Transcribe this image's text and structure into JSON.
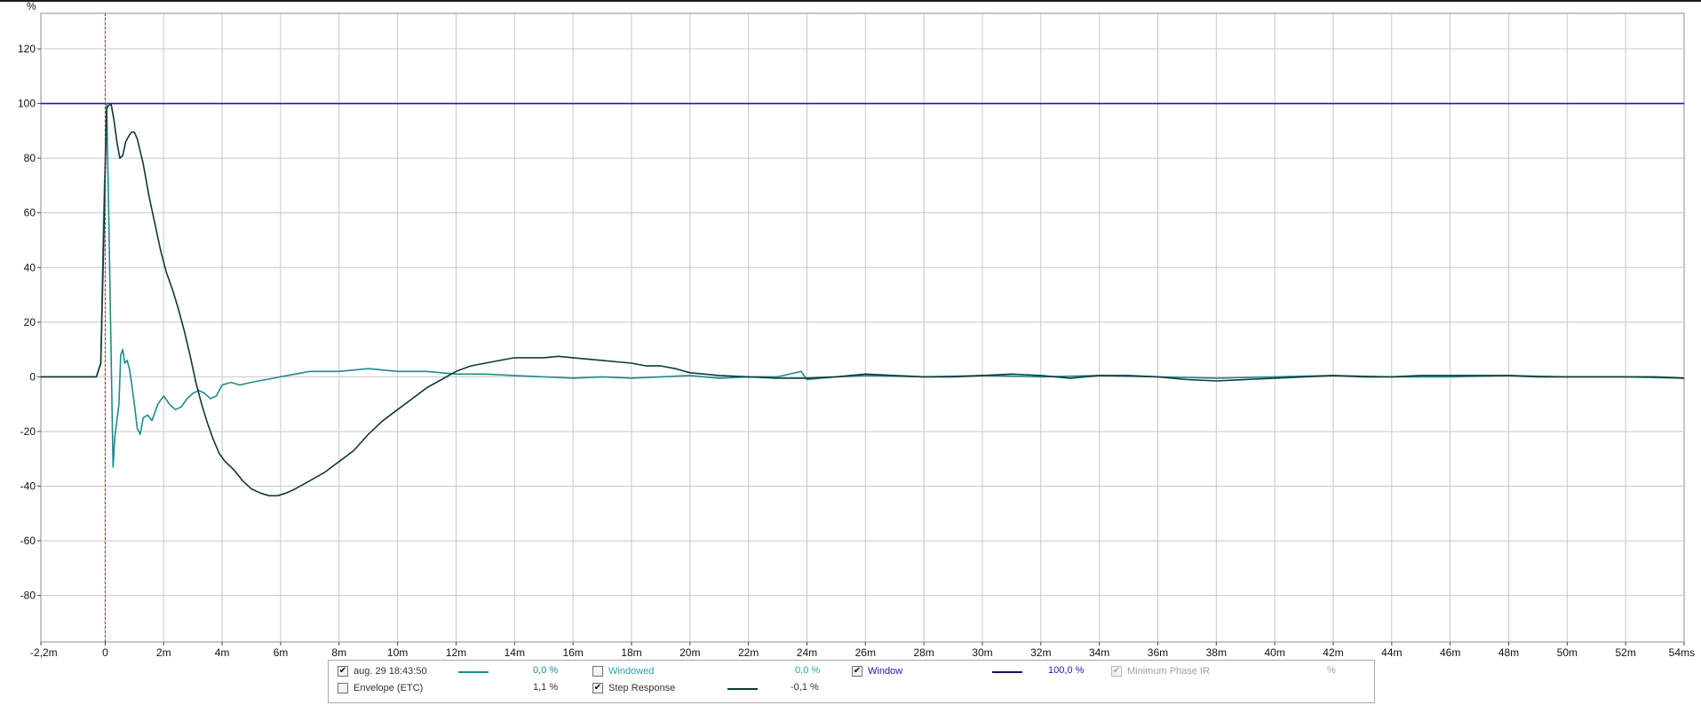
{
  "chart_data": {
    "type": "line",
    "ylabel": "%",
    "xlim": [
      -2.2,
      54
    ],
    "ylim": [
      -97,
      133
    ],
    "x_ticks": [
      {
        "v": -2.2,
        "label": "-2,2m"
      },
      {
        "v": 0,
        "label": "0"
      },
      {
        "v": 2,
        "label": "2m"
      },
      {
        "v": 4,
        "label": "4m"
      },
      {
        "v": 6,
        "label": "6m"
      },
      {
        "v": 8,
        "label": "8m"
      },
      {
        "v": 10,
        "label": "10m"
      },
      {
        "v": 12,
        "label": "12m"
      },
      {
        "v": 14,
        "label": "14m"
      },
      {
        "v": 16,
        "label": "16m"
      },
      {
        "v": 18,
        "label": "18m"
      },
      {
        "v": 20,
        "label": "20m"
      },
      {
        "v": 22,
        "label": "22m"
      },
      {
        "v": 24,
        "label": "24m"
      },
      {
        "v": 26,
        "label": "26m"
      },
      {
        "v": 28,
        "label": "28m"
      },
      {
        "v": 30,
        "label": "30m"
      },
      {
        "v": 32,
        "label": "32m"
      },
      {
        "v": 34,
        "label": "34m"
      },
      {
        "v": 36,
        "label": "36m"
      },
      {
        "v": 38,
        "label": "38m"
      },
      {
        "v": 40,
        "label": "40m"
      },
      {
        "v": 42,
        "label": "42m"
      },
      {
        "v": 44,
        "label": "44m"
      },
      {
        "v": 46,
        "label": "46m"
      },
      {
        "v": 48,
        "label": "48m"
      },
      {
        "v": 50,
        "label": "50m"
      },
      {
        "v": 52,
        "label": "52m"
      },
      {
        "v": 54,
        "label": "54ms"
      }
    ],
    "y_ticks": [
      {
        "v": 120,
        "label": "120"
      },
      {
        "v": 100,
        "label": "100"
      },
      {
        "v": 80,
        "label": "80"
      },
      {
        "v": 60,
        "label": "60"
      },
      {
        "v": 40,
        "label": "40"
      },
      {
        "v": 20,
        "label": "20"
      },
      {
        "v": 0,
        "label": "0"
      },
      {
        "v": -20,
        "label": "-20"
      },
      {
        "v": -40,
        "label": "-40"
      },
      {
        "v": -60,
        "label": "-60"
      },
      {
        "v": -80,
        "label": "-80"
      }
    ],
    "grid": true,
    "marker_x": 0,
    "series": [
      {
        "name": "Window",
        "color": "#1c1ca8",
        "points": [
          [
            -2.2,
            100
          ],
          [
            54,
            100
          ]
        ]
      },
      {
        "name": "aug. 29 18:43:50",
        "color": "#1f8a8a",
        "points": [
          [
            -2.2,
            0
          ],
          [
            -1.2,
            0
          ],
          [
            -0.3,
            0
          ],
          [
            -0.15,
            5
          ],
          [
            -0.05,
            60
          ],
          [
            0.05,
            100
          ],
          [
            0.12,
            60
          ],
          [
            0.2,
            10
          ],
          [
            0.27,
            -33
          ],
          [
            0.33,
            -22
          ],
          [
            0.4,
            -16
          ],
          [
            0.47,
            -10
          ],
          [
            0.53,
            8
          ],
          [
            0.6,
            10
          ],
          [
            0.67,
            5
          ],
          [
            0.75,
            6
          ],
          [
            0.83,
            3
          ],
          [
            0.9,
            -2
          ],
          [
            1.0,
            -10
          ],
          [
            1.1,
            -19
          ],
          [
            1.2,
            -21
          ],
          [
            1.3,
            -15
          ],
          [
            1.45,
            -14
          ],
          [
            1.6,
            -16
          ],
          [
            1.8,
            -10
          ],
          [
            2.0,
            -7
          ],
          [
            2.2,
            -10
          ],
          [
            2.4,
            -12
          ],
          [
            2.6,
            -11
          ],
          [
            2.8,
            -8
          ],
          [
            3.0,
            -6
          ],
          [
            3.2,
            -5
          ],
          [
            3.4,
            -6
          ],
          [
            3.6,
            -8
          ],
          [
            3.8,
            -7
          ],
          [
            4.0,
            -3
          ],
          [
            4.3,
            -2
          ],
          [
            4.6,
            -3
          ],
          [
            5.0,
            -2
          ],
          [
            5.5,
            -1
          ],
          [
            6.0,
            0
          ],
          [
            6.5,
            1
          ],
          [
            7.0,
            2
          ],
          [
            8.0,
            2
          ],
          [
            9.0,
            3
          ],
          [
            10.0,
            2
          ],
          [
            11.0,
            2
          ],
          [
            12.0,
            1
          ],
          [
            13.0,
            1
          ],
          [
            14.0,
            0.5
          ],
          [
            15.0,
            0
          ],
          [
            16.0,
            -0.5
          ],
          [
            17.0,
            0
          ],
          [
            18.0,
            -0.5
          ],
          [
            19.0,
            0
          ],
          [
            20.0,
            0.5
          ],
          [
            21.0,
            -0.5
          ],
          [
            22.0,
            0
          ],
          [
            23.0,
            0
          ],
          [
            23.8,
            2
          ],
          [
            24.0,
            -1
          ],
          [
            25.0,
            0
          ],
          [
            26.0,
            0.5
          ],
          [
            28.0,
            0
          ],
          [
            30.0,
            0.5
          ],
          [
            32.0,
            0
          ],
          [
            34.0,
            0.5
          ],
          [
            36.0,
            0
          ],
          [
            38.0,
            -0.5
          ],
          [
            40.0,
            0
          ],
          [
            42.0,
            0.5
          ],
          [
            44.0,
            0
          ],
          [
            46.0,
            0
          ],
          [
            48.0,
            0.5
          ],
          [
            50.0,
            0
          ],
          [
            52.0,
            0
          ],
          [
            54.0,
            -0.5
          ]
        ]
      },
      {
        "name": "Step Response",
        "color": "#0e3a3a",
        "points": [
          [
            -2.2,
            0
          ],
          [
            -0.3,
            0
          ],
          [
            -0.15,
            5
          ],
          [
            -0.05,
            50
          ],
          [
            0.05,
            98
          ],
          [
            0.1,
            99
          ],
          [
            0.2,
            100
          ],
          [
            0.3,
            94
          ],
          [
            0.4,
            86
          ],
          [
            0.5,
            80
          ],
          [
            0.6,
            81
          ],
          [
            0.7,
            86
          ],
          [
            0.8,
            88
          ],
          [
            0.9,
            89.5
          ],
          [
            1.0,
            89.5
          ],
          [
            1.1,
            87
          ],
          [
            1.3,
            78
          ],
          [
            1.5,
            66
          ],
          [
            1.7,
            56
          ],
          [
            1.9,
            46
          ],
          [
            2.1,
            38
          ],
          [
            2.3,
            32
          ],
          [
            2.5,
            25
          ],
          [
            2.7,
            17
          ],
          [
            2.9,
            8
          ],
          [
            3.1,
            -2
          ],
          [
            3.3,
            -10
          ],
          [
            3.5,
            -17
          ],
          [
            3.7,
            -23
          ],
          [
            3.9,
            -28
          ],
          [
            4.1,
            -31
          ],
          [
            4.4,
            -34
          ],
          [
            4.7,
            -38
          ],
          [
            5.0,
            -41
          ],
          [
            5.3,
            -42.5
          ],
          [
            5.6,
            -43.5
          ],
          [
            5.9,
            -43.5
          ],
          [
            6.2,
            -42.5
          ],
          [
            6.5,
            -41
          ],
          [
            7.0,
            -38
          ],
          [
            7.5,
            -35
          ],
          [
            8.0,
            -31
          ],
          [
            8.5,
            -27
          ],
          [
            9.0,
            -21
          ],
          [
            9.5,
            -16
          ],
          [
            10.0,
            -12
          ],
          [
            10.5,
            -8
          ],
          [
            11.0,
            -4
          ],
          [
            11.5,
            -1
          ],
          [
            12.0,
            2
          ],
          [
            12.5,
            4
          ],
          [
            13.0,
            5
          ],
          [
            13.5,
            6
          ],
          [
            14.0,
            7
          ],
          [
            14.5,
            7
          ],
          [
            15.0,
            7
          ],
          [
            15.5,
            7.5
          ],
          [
            16.0,
            7
          ],
          [
            16.5,
            6.5
          ],
          [
            17.0,
            6
          ],
          [
            17.5,
            5.5
          ],
          [
            18.0,
            5
          ],
          [
            18.5,
            4
          ],
          [
            19.0,
            4
          ],
          [
            19.5,
            3
          ],
          [
            20.0,
            1.5
          ],
          [
            20.5,
            1
          ],
          [
            21.0,
            0.5
          ],
          [
            22.0,
            0
          ],
          [
            23.0,
            -0.5
          ],
          [
            24.0,
            -0.5
          ],
          [
            25.0,
            0
          ],
          [
            26.0,
            1
          ],
          [
            27.0,
            0.5
          ],
          [
            28.0,
            0
          ],
          [
            29.0,
            0
          ],
          [
            30.0,
            0.5
          ],
          [
            31.0,
            1
          ],
          [
            32.0,
            0.5
          ],
          [
            33.0,
            -0.5
          ],
          [
            34.0,
            0.5
          ],
          [
            35.0,
            0.5
          ],
          [
            36.0,
            0
          ],
          [
            37.0,
            -1
          ],
          [
            38.0,
            -1.5
          ],
          [
            39.0,
            -1
          ],
          [
            40.0,
            -0.5
          ],
          [
            41.0,
            0
          ],
          [
            42.0,
            0.5
          ],
          [
            43.0,
            0
          ],
          [
            44.0,
            0
          ],
          [
            45.0,
            0.5
          ],
          [
            46.0,
            0.5
          ],
          [
            47.0,
            0.5
          ],
          [
            48.0,
            0.5
          ],
          [
            49.0,
            0
          ],
          [
            50.0,
            0
          ],
          [
            51.0,
            0
          ],
          [
            52.0,
            0
          ],
          [
            53.0,
            0
          ],
          [
            54.0,
            -0.5
          ]
        ]
      }
    ]
  },
  "legend": {
    "items": [
      {
        "label": "aug. 29 18:43:50",
        "checked": true,
        "enabled": true,
        "value": "0,0 %",
        "color": "#1f8a8a",
        "label_color": "#333333",
        "value_color": "#1f8a8a",
        "swatch": true
      },
      {
        "label": "Windowed",
        "checked": false,
        "enabled": true,
        "value": "0,0 %",
        "color": "#2aa3a3",
        "label_color": "#2aa3a3",
        "value_color": "#2aa3a3",
        "swatch": false
      },
      {
        "label": "Window",
        "checked": true,
        "enabled": true,
        "value": "100,0 %",
        "color": "#101060",
        "label_color": "#1c1ca8",
        "value_color": "#1c1ca8",
        "swatch": true
      },
      {
        "label": "Minimum Phase IR",
        "checked": true,
        "enabled": false,
        "value": "%",
        "color": "#aaaaaa",
        "label_color": "#a0a0a0",
        "value_color": "#a0a0a0",
        "swatch": false
      },
      {
        "label": "Envelope (ETC)",
        "checked": false,
        "enabled": true,
        "value": "1,1 %",
        "color": "#333333",
        "label_color": "#333333",
        "value_color": "#333333",
        "swatch": false
      },
      {
        "label": "Step Response",
        "checked": true,
        "enabled": true,
        "value": "-0,1 %",
        "color": "#0e3a3a",
        "label_color": "#333333",
        "value_color": "#333333",
        "swatch": true
      }
    ]
  }
}
